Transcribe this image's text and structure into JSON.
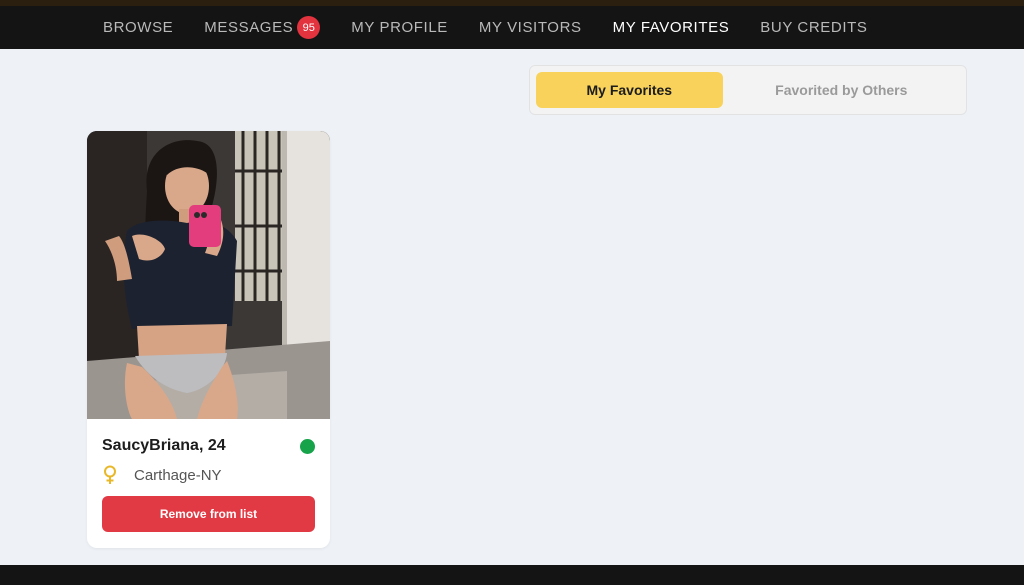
{
  "nav": {
    "items": [
      {
        "label": "BROWSE"
      },
      {
        "label": "MESSAGES",
        "badge": "95"
      },
      {
        "label": "MY PROFILE"
      },
      {
        "label": "MY VISITORS"
      },
      {
        "label": "MY FAVORITES",
        "active": true
      },
      {
        "label": "BUY CREDITS"
      }
    ]
  },
  "tabs": {
    "my_favorites": "My Favorites",
    "favorited_by_others": "Favorited by Others",
    "active": "my_favorites"
  },
  "favorites": [
    {
      "name_age": "SaucyBriana, 24",
      "location": "Carthage-NY",
      "online": true,
      "gender_icon": "female-symbol-icon",
      "remove_label": "Remove from list"
    }
  ],
  "colors": {
    "nav_bg": "#141414",
    "badge": "#e2333f",
    "tab_active": "#f8d25a",
    "remove_button": "#e23a45",
    "online": "#17a34a",
    "page_bg": "#eef2f7"
  }
}
